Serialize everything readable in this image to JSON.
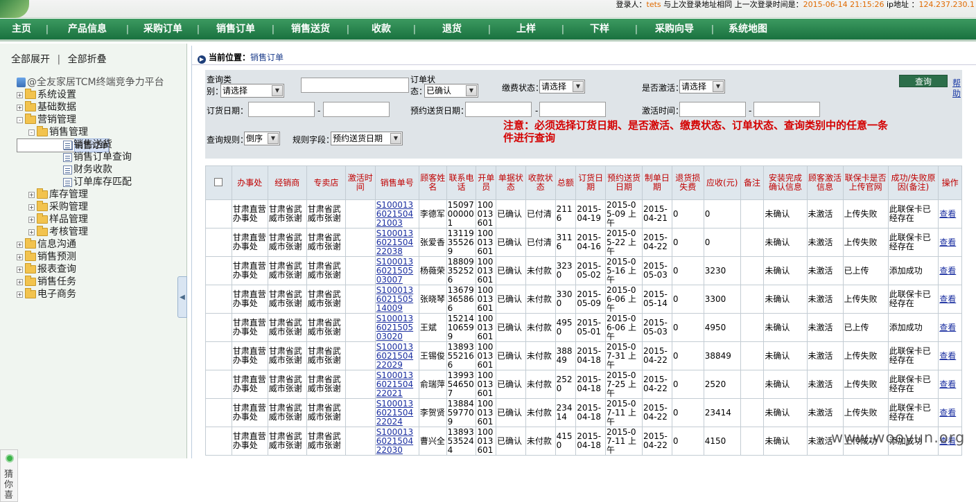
{
  "header": {
    "login_label": "登录人：",
    "user": "tets",
    "same_addr_text": "与上次登录地址相同",
    "last_login_label": "上一次登录时间是：",
    "last_login_time": "2015-06-14 21:15:26",
    "ip_label": "ip地址 ：",
    "ip": "124.237.230.1",
    "accent_color": "#e06a00"
  },
  "nav": {
    "items": [
      "主页",
      "产品信息",
      "采购订单",
      "销售订单",
      "销售送货",
      "收款",
      "退货",
      "上样",
      "下样",
      "采购向导",
      "系统地图"
    ]
  },
  "sidebar": {
    "expand_all": "全部展开",
    "collapse_all": "全部折叠",
    "divider": "|",
    "root": "@全友家居TCM终端竞争力平台",
    "items": [
      {
        "label": "系统设置",
        "level": 1,
        "type": "folder",
        "state": "+"
      },
      {
        "label": "基础数据",
        "level": 1,
        "type": "folder",
        "state": "+"
      },
      {
        "label": "营销管理",
        "level": 1,
        "type": "folder",
        "state": "-"
      },
      {
        "label": "销售管理",
        "level": 2,
        "type": "folder",
        "state": "-"
      },
      {
        "label": "销售订单",
        "level": 3,
        "type": "doc",
        "selected": true
      },
      {
        "label": "销售送货",
        "level": 3,
        "type": "doc"
      },
      {
        "label": "销售订单查询",
        "level": 3,
        "type": "doc"
      },
      {
        "label": "财务收款",
        "level": 3,
        "type": "doc"
      },
      {
        "label": "订单库存匹配",
        "level": 3,
        "type": "doc"
      },
      {
        "label": "库存管理",
        "level": 2,
        "type": "folder",
        "state": "+"
      },
      {
        "label": "采购管理",
        "level": 2,
        "type": "folder",
        "state": "+"
      },
      {
        "label": "样品管理",
        "level": 2,
        "type": "folder",
        "state": "+"
      },
      {
        "label": "考核管理",
        "level": 2,
        "type": "folder",
        "state": "+"
      },
      {
        "label": "信息沟通",
        "level": 1,
        "type": "folder",
        "state": "+"
      },
      {
        "label": "销售预测",
        "level": 1,
        "type": "folder",
        "state": "+"
      },
      {
        "label": "报表查询",
        "level": 1,
        "type": "folder",
        "state": "+"
      },
      {
        "label": "销售任务",
        "level": 1,
        "type": "folder",
        "state": "+"
      },
      {
        "label": "电子商务",
        "level": 1,
        "type": "folder",
        "state": "+"
      }
    ],
    "guess_text": "猜你喜"
  },
  "breadcrumb": {
    "label": "当前位置：",
    "current": "销售订单"
  },
  "query": {
    "query_type_label": "查询类别：",
    "query_type_value": "请选择",
    "query_text_value": "",
    "order_status_label": "订单状态：",
    "order_status_value": "已确认",
    "pay_status_label": "缴费状态：",
    "pay_status_value": "请选择",
    "activated_label": "是否激活：",
    "activated_value": "请选择",
    "query_button": "查询",
    "help_link": "帮助",
    "order_date_label": "订货日期：",
    "order_date_from": "",
    "order_date_to": "",
    "delivery_date_label": "预约送货日期：",
    "delivery_date_from": "",
    "delivery_date_to": "",
    "activate_time_label": "激活时间：",
    "activate_time_from": "",
    "activate_time_to": "",
    "range_dash": "-",
    "rule_label": "查询规则：",
    "rule_value": "倒序",
    "rule_field_label": "规则字段：",
    "rule_field_value": "预约送货日期",
    "notice": "注意：必须选择订货日期、是否激活、缴费状态、订单状态、查询类别中的任意一条件进行查询",
    "notice_color": "#d40000"
  },
  "table": {
    "headers": [
      "",
      "办事处",
      "经销商",
      "专卖店",
      "激活时间",
      "销售单号",
      "顾客姓名",
      "联系电话",
      "开单员",
      "单据状态",
      "收款状态",
      "总额",
      "订货日期",
      "预约送货日期",
      "制单日期",
      "退货损失费",
      "应收(元)",
      "备注",
      "安装完成确认信息",
      "顾客激活信息",
      "联保卡是否上传官网",
      "成功/失败原因(备注)",
      "操作"
    ],
    "rows": [
      [
        "",
        "甘肃直营办事处",
        "甘肃省武威市张谢",
        "甘肃省武威市张谢",
        "",
        "S100013602150421003",
        "李德军",
        "15097000001",
        "100013601",
        "已确认",
        "已付清",
        "2116",
        "2015-04-19",
        "2015-05-09 上午",
        "2015-04-21",
        "0",
        "0",
        "",
        "未确认",
        "未激活",
        "上传失败",
        "此联保卡已经存在",
        "查看"
      ],
      [
        "",
        "甘肃直营办事处",
        "甘肃省武威市张谢",
        "甘肃省武威市张谢",
        "",
        "S100013602150422038",
        "张爱香",
        "13119355269",
        "100013601",
        "已确认",
        "已付清",
        "3116",
        "2015-04-16",
        "2015-05-22 上午",
        "2015-04-22",
        "0",
        "0",
        "",
        "未确认",
        "未激活",
        "上传失败",
        "此联保卡已经存在",
        "查看"
      ],
      [
        "",
        "甘肃直营办事处",
        "甘肃省武威市张谢",
        "甘肃省武威市张谢",
        "",
        "S100013602150503007",
        "杨薇荣",
        "18809352526",
        "100013601",
        "已确认",
        "未付款",
        "3230",
        "2015-05-02",
        "2015-05-16 上午",
        "2015-05-03",
        "0",
        "3230",
        "",
        "未确认",
        "未激活",
        "已上传",
        "添加成功",
        "查看"
      ],
      [
        "",
        "甘肃直营办事处",
        "甘肃省武威市张谢",
        "甘肃省武威市张谢",
        "",
        "S100013602150514009",
        "张晓琴",
        "13679365866",
        "100013601",
        "已确认",
        "未付款",
        "3300",
        "2015-05-09",
        "2015-06-06 上午",
        "2015-05-14",
        "0",
        "3300",
        "",
        "未确认",
        "未激活",
        "上传失败",
        "此联保卡已经存在",
        "查看"
      ],
      [
        "",
        "甘肃直营办事处",
        "甘肃省武威市张谢",
        "甘肃省武威市张谢",
        "",
        "S100013602150503020",
        "王斌",
        "15214106599",
        "100013601",
        "已确认",
        "未付款",
        "4950",
        "2015-05-01",
        "2015-06-06 上午",
        "2015-05-03",
        "0",
        "4950",
        "",
        "未确认",
        "未激活",
        "已上传",
        "添加成功",
        "查看"
      ],
      [
        "",
        "甘肃直营办事处",
        "甘肃省武威市张谢",
        "甘肃省武威市张谢",
        "",
        "S100013602150422029",
        "王锡俊",
        "13893552166",
        "100013601",
        "已确认",
        "未付款",
        "38849",
        "2015-04-18",
        "2015-07-31 上午",
        "2015-04-22",
        "0",
        "38849",
        "",
        "未确认",
        "未激活",
        "上传失败",
        "此联保卡已经存在",
        "查看"
      ],
      [
        "",
        "甘肃直营办事处",
        "甘肃省武威市张谢",
        "甘肃省武威市张谢",
        "",
        "S100013602150422021",
        "俞瑞萍",
        "13993546507",
        "100013601",
        "已确认",
        "未付款",
        "2520",
        "2015-04-18",
        "2015-07-25 上午",
        "2015-04-22",
        "0",
        "2520",
        "",
        "未确认",
        "未激活",
        "上传失败",
        "此联保卡已经存在",
        "查看"
      ],
      [
        "",
        "甘肃直营办事处",
        "甘肃省武威市张谢",
        "甘肃省武威市张谢",
        "",
        "S100013602150422024",
        "李贺贤",
        "13884597709",
        "100013601",
        "已确认",
        "未付款",
        "23414",
        "2015-04-18",
        "2015-07-11 上午",
        "2015-04-22",
        "0",
        "23414",
        "",
        "未确认",
        "未激活",
        "上传失败",
        "此联保卡已经存在",
        "查看"
      ],
      [
        "",
        "甘肃直营办事处",
        "甘肃省武威市张谢",
        "甘肃省武威市张谢",
        "",
        "S100013602150422030",
        "曹兴全",
        "13893535244",
        "100013601",
        "已确认",
        "未付款",
        "4150",
        "2015-04-18",
        "2015-07-11 上午",
        "2015-04-22",
        "0",
        "4150",
        "",
        "未确认",
        "未激活",
        "上传成功",
        "添加成功",
        "查看"
      ]
    ]
  },
  "watermark": "www.wooyun.org"
}
